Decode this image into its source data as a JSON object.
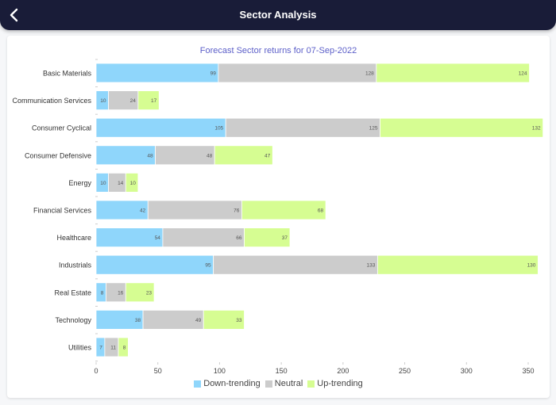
{
  "header": {
    "title": "Sector Analysis",
    "back_icon": "chevron-left-icon"
  },
  "colors": {
    "down": "#8fd6fb",
    "neutral": "#cccccc",
    "up": "#d6fd92",
    "title": "#5d60c9"
  },
  "chart_data": {
    "type": "bar",
    "orientation": "horizontal",
    "stacked": true,
    "title": "Forecast Sector returns for 07-Sep-2022",
    "xlabel": "",
    "ylabel": "",
    "xlim": [
      0,
      350
    ],
    "xticks": [
      0,
      50,
      100,
      150,
      200,
      250,
      300,
      350
    ],
    "grid": false,
    "legend_position": "bottom",
    "categories": [
      "Basic Materials",
      "Communication Services",
      "Consumer Cyclical",
      "Consumer Defensive",
      "Energy",
      "Financial Services",
      "Healthcare",
      "Industrials",
      "Real Estate",
      "Technology",
      "Utilities"
    ],
    "series": [
      {
        "name": "Down-trending",
        "color_key": "down",
        "values": [
          99,
          10,
          105,
          48,
          10,
          42,
          54,
          95,
          8,
          38,
          7
        ]
      },
      {
        "name": "Neutral",
        "color_key": "neutral",
        "values": [
          128,
          24,
          125,
          48,
          14,
          76,
          66,
          133,
          16,
          49,
          11
        ]
      },
      {
        "name": "Up-trending",
        "color_key": "up",
        "values": [
          124,
          17,
          132,
          47,
          10,
          68,
          37,
          130,
          23,
          33,
          8
        ]
      }
    ]
  }
}
